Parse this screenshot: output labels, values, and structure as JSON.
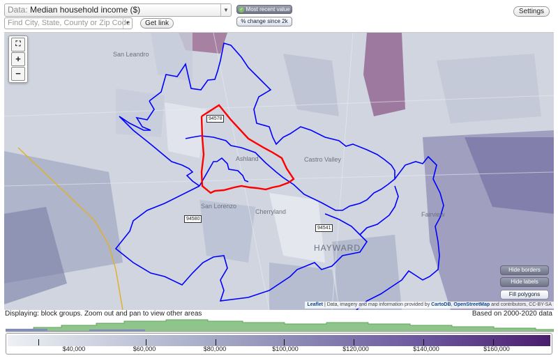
{
  "controls": {
    "data_prefix": "Data:",
    "data_value": "Median household income ($)",
    "search_placeholder": "Find City, State, County or Zip Code",
    "get_link": "Get link",
    "most_recent": "Most recent value",
    "pct_change": "% change since 2k",
    "settings": "Settings"
  },
  "map": {
    "places": [
      "San Leandro",
      "Castro Valley",
      "Ashland",
      "San Lorenzo",
      "Cherryland",
      "HAYWARD",
      "Fairview"
    ],
    "zips": [
      "94578",
      "94580",
      "94541"
    ],
    "buttons": {
      "hide_borders": "Hide borders",
      "hide_labels": "Hide labels",
      "fill_polygons": "Fill polygons"
    },
    "attribution": {
      "leaflet": "Leaflet",
      "text1": " | Data, imagery and map information provided by ",
      "carto": "CartoDB",
      "text2": ", ",
      "osm": "OpenStreetMap",
      "text3": " and contributors, CC-BY-SA"
    },
    "zoom": {
      "plus": "+",
      "minus": "−"
    }
  },
  "footer": {
    "displaying": "Displaying: block groups. Zoom out and pan to view other areas",
    "based_on": "Based on 2000-2020 data"
  },
  "legend": {
    "labels": [
      "$40,000",
      "$60,000",
      "$80,000",
      "$100,000",
      "$120,000",
      "$140,000",
      "$160,000"
    ],
    "colors": {
      "low": "#eef0f4",
      "high": "#4b1d6e",
      "border_red": "#ff0000",
      "border_blue": "#0000ff",
      "highway": "#e0b030"
    }
  }
}
